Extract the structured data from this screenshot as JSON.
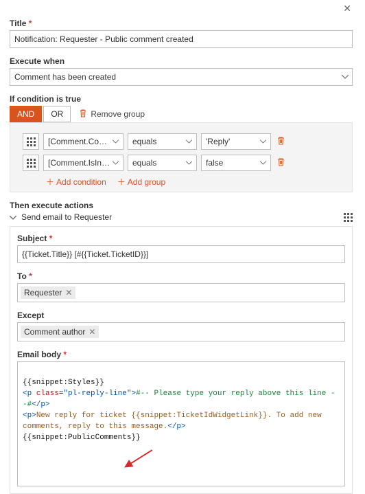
{
  "close_glyph": "✕",
  "title": {
    "label": "Title",
    "value": "Notification: Requester - Public comment created"
  },
  "execute_when": {
    "label": "Execute when",
    "value": "Comment has been created"
  },
  "condition": {
    "label": "If condition is true",
    "tabs": {
      "and": "AND",
      "or": "OR"
    },
    "remove_group": "Remove group",
    "rules": [
      {
        "field": "[Comment.CommentTy…",
        "op": "equals",
        "value": "Reply"
      },
      {
        "field": "[Comment.IsInitial]",
        "op": "equals",
        "value": "false"
      }
    ],
    "add_condition": "Add condition",
    "add_group": "Add group"
  },
  "actions": {
    "label": "Then execute actions",
    "name": "Send email to Requester",
    "subject": {
      "label": "Subject",
      "value": "{{Ticket.Title}} [#{{Ticket.TicketID}}]"
    },
    "to": {
      "label": "To",
      "chips": [
        "Requester"
      ]
    },
    "except": {
      "label": "Except",
      "chips": [
        "Comment author"
      ]
    },
    "body": {
      "label": "Email body",
      "line1": "{{snippet:Styles}}",
      "line2a": "<p ",
      "line2b": "class",
      "line2c": "=",
      "line2d": "\"pl-reply-line\"",
      "line2e": ">",
      "line2f": "#-- Please type your reply above this line --#",
      "line2g": "</p>",
      "line3a": "<p>",
      "line3b": "New reply for ticket {{snippet:TicketIdWidgetLink}}. To add new comments, reply to this message.",
      "line3c": "</p>",
      "line4": "{{snippet:PublicComments}}"
    }
  }
}
